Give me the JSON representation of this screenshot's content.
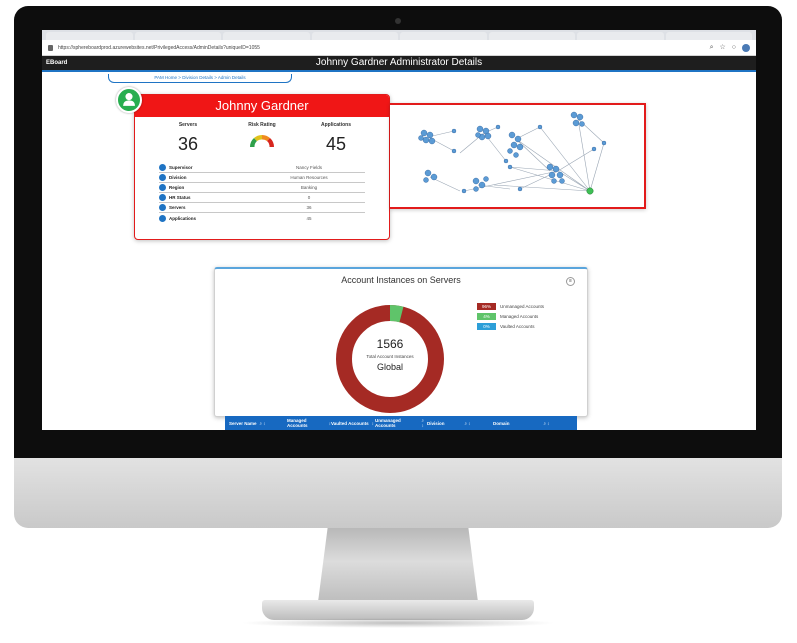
{
  "browser": {
    "url": "https://sphereboardprod.azurewebsites.net/PrivilegedAccess/AdminDetails?uniqueID=1055"
  },
  "app": {
    "brand": "EBoard",
    "title": "Johnny Gardner Administrator Details"
  },
  "breadcrumb": "PAM Home > Division Details > Admin Details",
  "profile": {
    "name": "Johnny Gardner",
    "stats": [
      {
        "label": "Servers",
        "value": "36"
      },
      {
        "label": "Risk Rating",
        "value": ""
      },
      {
        "label": "Applications",
        "value": "45"
      }
    ],
    "info": [
      {
        "label": "Supervisor",
        "value": "Nancy Fields"
      },
      {
        "label": "Division",
        "value": "Human Resources"
      },
      {
        "label": "Region",
        "value": "Banking"
      },
      {
        "label": "HR Status",
        "value": "0"
      },
      {
        "label": "Servers",
        "value": "36"
      },
      {
        "label": "Applications",
        "value": "45"
      }
    ]
  },
  "account_instances": {
    "title": "Account Instances on Servers",
    "total": "1566",
    "total_label": "Total Account Instances",
    "scope": "Global",
    "legend": [
      {
        "pct": "96%",
        "label": "Unmanaged Accounts",
        "color": "#a52a24"
      },
      {
        "pct": "4%",
        "label": "Managed Accounts",
        "color": "#5fc46a"
      },
      {
        "pct": "0%",
        "label": "Vaulted Accounts",
        "color": "#2d9fd8"
      }
    ]
  },
  "table": {
    "columns": [
      "Server Name",
      "Managed Accounts",
      "Vaulted Accounts",
      "Unmanaged Accounts",
      "Division",
      "Domain"
    ]
  },
  "colors": {
    "accent_red": "#f01616",
    "primary_blue": "#1f74c4",
    "user_green": "#27ae4f"
  }
}
